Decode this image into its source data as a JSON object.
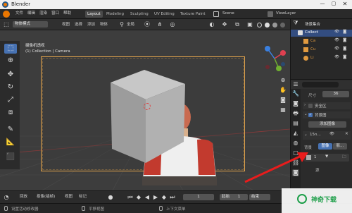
{
  "titlebar": {
    "app_title": "Blender"
  },
  "menubar": {
    "items": [
      "文件",
      "编辑",
      "渲染",
      "窗口",
      "帮助"
    ],
    "workspace_tabs": [
      "Layout",
      "Modeling",
      "Sculpting",
      "UV Editing",
      "Texture Paint"
    ],
    "scene_label": "Scene",
    "view_layer_label": "ViewLayer"
  },
  "viewport_header": {
    "mode": "物体模式",
    "menus": [
      "视图",
      "选择",
      "添加",
      "物体"
    ],
    "transform_orientation": "全局",
    "options_label": "选项"
  },
  "viewport": {
    "view_name": "摄像机透视",
    "collection_path": "(1) Collection | Camera"
  },
  "outliner": {
    "header": "场景集合",
    "items": [
      {
        "label": "Collect"
      },
      {
        "label": "Ca"
      },
      {
        "label": "Cu"
      },
      {
        "label": "Li"
      }
    ]
  },
  "properties": {
    "size_label": "尺寸",
    "size_value": "36",
    "shift_label": "安全区",
    "background_images_label": "背景图",
    "add_image_label": "添加图像",
    "image_name": "15n...",
    "source_label": "背景",
    "image_button": "图像",
    "movie_button": "影...",
    "frame_value": "1",
    "alpha_label": "源"
  },
  "timeline": {
    "menus": [
      "回放",
      "抠像(插帧)",
      "视图",
      "标记"
    ],
    "current_frame": "1",
    "start_label": "起始",
    "start_value": "1",
    "end_label": "结束"
  },
  "statusbar": {
    "items": [
      "设置活动修改器",
      "平移视图",
      "上下文菜单"
    ]
  },
  "watermark": {
    "text": "神奇下载"
  },
  "colors": {
    "accent": "#4772b3",
    "arrow": "#e81c1c",
    "camera_frame": "#e6a64c"
  }
}
